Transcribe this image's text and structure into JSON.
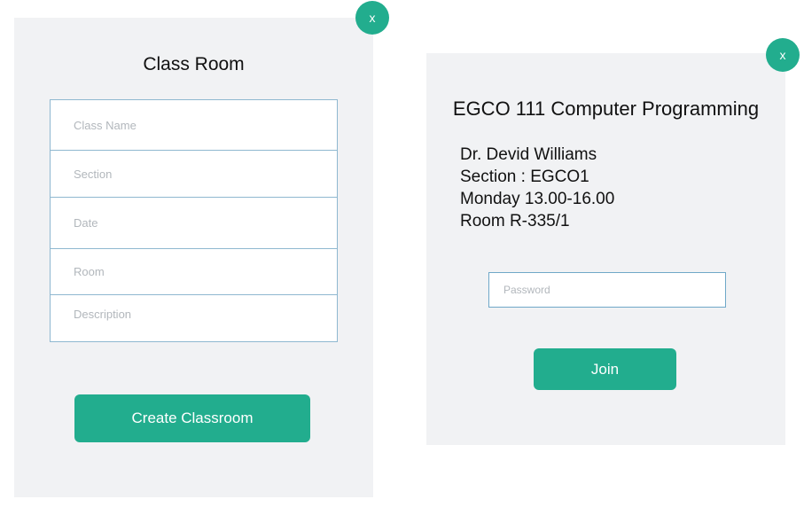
{
  "create_dialog": {
    "close_label": "x",
    "title": "Class Room",
    "fields": {
      "class_name_placeholder": "Class Name",
      "section_placeholder": "Section",
      "date_placeholder": "Date",
      "room_placeholder": "Room",
      "description_placeholder": "Description"
    },
    "submit_label": "Create Classroom"
  },
  "join_dialog": {
    "close_label": "x",
    "course_title": "EGCO 111 Computer Programming",
    "teacher": "Dr. Devid Williams",
    "section": "Section : EGCO1",
    "schedule": "Monday 13.00-16.00",
    "room": "Room R-335/1",
    "password_placeholder": "Password",
    "join_label": "Join"
  },
  "colors": {
    "accent": "#22ad8e",
    "panel_bg": "#f1f2f4",
    "field_border": "#8fb8d0"
  }
}
